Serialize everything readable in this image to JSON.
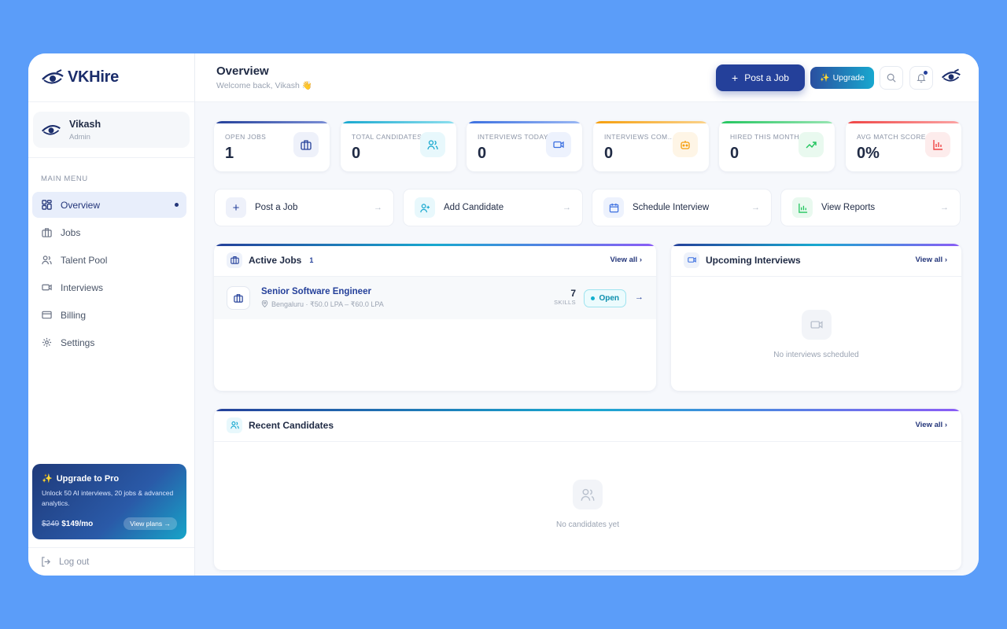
{
  "brand": {
    "name": "VKHire"
  },
  "user": {
    "name": "Vikash",
    "role": "Admin"
  },
  "sidebar": {
    "menu_heading": "MAIN MENU",
    "items": [
      {
        "label": "Overview",
        "icon": "grid-icon",
        "active": true
      },
      {
        "label": "Jobs",
        "icon": "briefcase-icon"
      },
      {
        "label": "Talent Pool",
        "icon": "users-icon"
      },
      {
        "label": "Interviews",
        "icon": "video-icon"
      },
      {
        "label": "Billing",
        "icon": "credit-card-icon"
      },
      {
        "label": "Settings",
        "icon": "gear-icon"
      }
    ],
    "upgrade": {
      "title": "Upgrade to Pro",
      "description": "Unlock 50 AI interviews, 20 jobs & advanced analytics.",
      "old_price": "$249",
      "price": "$149/mo",
      "button": "View plans →"
    },
    "logout": "Log out"
  },
  "header": {
    "title": "Overview",
    "subtitle": "Welcome back, Vikash 👋",
    "post_job": "Post a Job",
    "upgrade": "Upgrade"
  },
  "stats": [
    {
      "label": "OPEN JOBS",
      "value": "1",
      "icon": "briefcase-icon",
      "color": "#24409a"
    },
    {
      "label": "TOTAL CANDIDATES",
      "value": "0",
      "icon": "users-icon",
      "color": "#18a8cf"
    },
    {
      "label": "INTERVIEWS TODAY",
      "value": "0",
      "icon": "video-icon",
      "color": "#3b6fe0"
    },
    {
      "label": "INTERVIEWS COMPLETED",
      "value": "0",
      "icon": "robot-icon",
      "color": "#f59e0b"
    },
    {
      "label": "HIRED THIS MONTH",
      "value": "0",
      "icon": "trending-up-icon",
      "color": "#22c55e"
    },
    {
      "label": "AVG MATCH SCORE",
      "value": "0%",
      "icon": "bar-chart-icon",
      "color": "#ef4444"
    }
  ],
  "actions": [
    {
      "label": "Post a Job",
      "icon": "plus-icon"
    },
    {
      "label": "Add Candidate",
      "icon": "user-plus-icon"
    },
    {
      "label": "Schedule Interview",
      "icon": "calendar-icon"
    },
    {
      "label": "View Reports",
      "icon": "bar-chart-icon"
    }
  ],
  "active_jobs": {
    "title": "Active Jobs",
    "count": "1",
    "view_all": "View all",
    "jobs": [
      {
        "title": "Senior Software Engineer",
        "meta": "Bengaluru · ₹50.0 LPA – ₹60.0 LPA",
        "skills": "7",
        "skills_label": "SKILLS",
        "status": "Open"
      }
    ]
  },
  "upcoming_interviews": {
    "title": "Upcoming Interviews",
    "view_all": "View all",
    "empty": "No interviews scheduled"
  },
  "recent_candidates": {
    "title": "Recent Candidates",
    "view_all": "View all",
    "empty": "No candidates yet"
  }
}
